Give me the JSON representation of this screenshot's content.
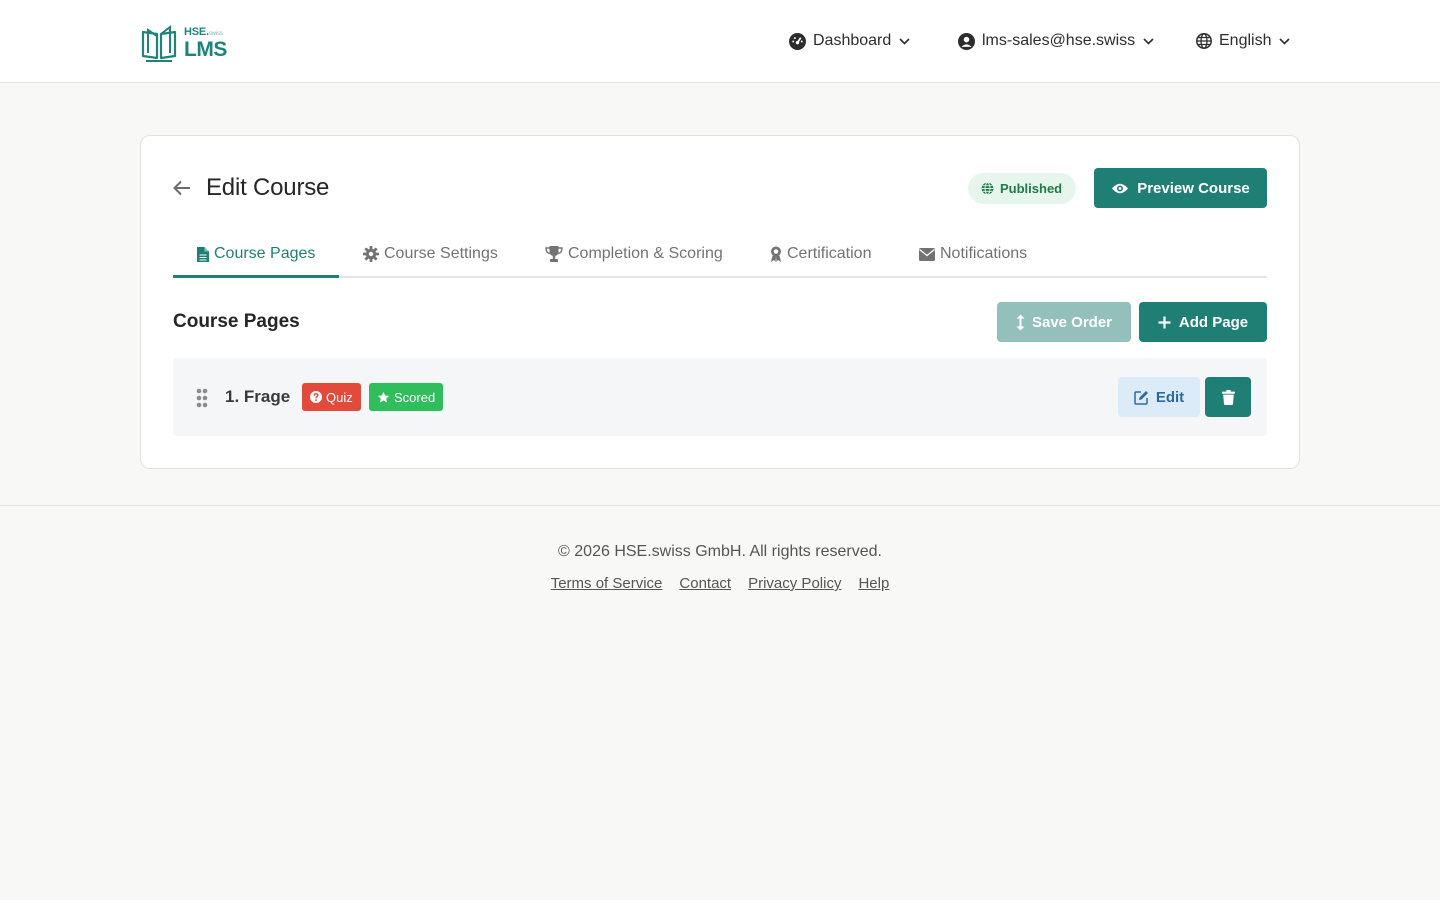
{
  "header": {
    "logo": {
      "brand_small": "HSE.",
      "brand_sub": "swiss",
      "brand_main": "LMS"
    },
    "nav": {
      "dashboard_label": "Dashboard",
      "user_label": "lms-sales@hse.swiss",
      "language_label": "English"
    }
  },
  "course": {
    "title": "Edit Course",
    "status": "Published",
    "preview_label": "Preview Course",
    "tabs": [
      {
        "label": "Course Pages",
        "icon": "file-icon",
        "active": true
      },
      {
        "label": "Course Settings",
        "icon": "gear-icon",
        "active": false
      },
      {
        "label": "Completion & Scoring",
        "icon": "trophy-icon",
        "active": false
      },
      {
        "label": "Certification",
        "icon": "award-icon",
        "active": false
      },
      {
        "label": "Notifications",
        "icon": "envelope-icon",
        "active": false
      }
    ],
    "pages_section": {
      "title": "Course Pages",
      "save_order_label": "Save Order",
      "add_page_label": "Add Page",
      "rows": [
        {
          "title": "1. Frage",
          "tags": [
            "Quiz",
            "Scored"
          ],
          "edit_label": "Edit"
        }
      ]
    }
  },
  "footer": {
    "copyright": "© 2026 HSE.swiss GmbH. All rights reserved.",
    "links": [
      "Terms of Service",
      "Contact",
      "Privacy Policy",
      "Help"
    ]
  },
  "colors": {
    "primary": "#1f7f74",
    "primary_disabled": "#93c0bb",
    "quiz_tag": "#e24a3b",
    "scored_tag": "#2fbe5b",
    "published_bg": "#e7f6ec",
    "published_text": "#1e7a46"
  }
}
